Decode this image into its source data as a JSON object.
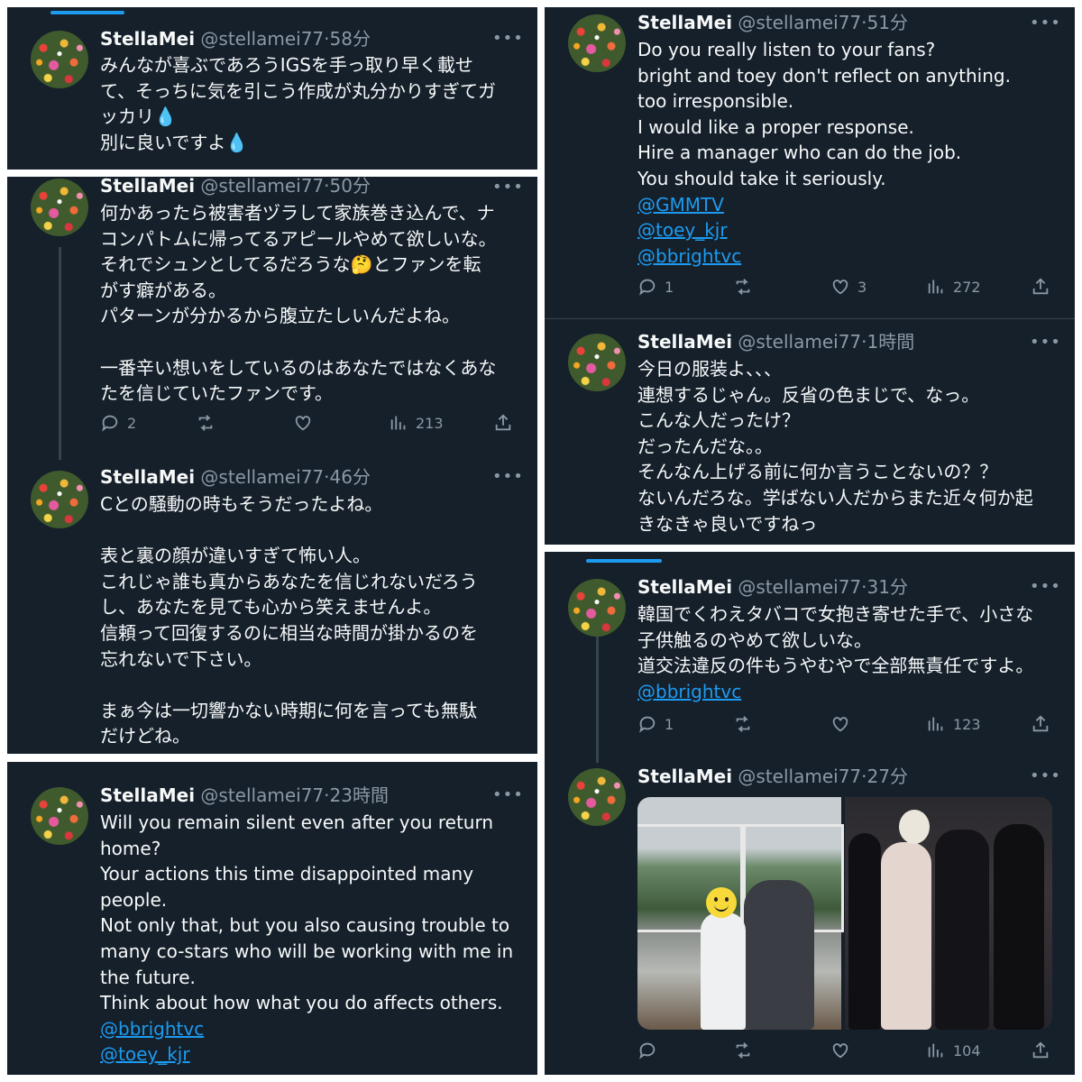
{
  "user": {
    "name": "StellaMei",
    "handle": "@stellamei77"
  },
  "tweets": [
    {
      "time": "·58分",
      "lines": [
        "みんなが喜ぶであろうIGSを手っ取り早く載せ",
        "て、そっちに気を引こう作成が丸分かりすぎてガ",
        "ッカリ💧",
        "別に良いですよ💧"
      ]
    },
    {
      "time": "·50分",
      "lines": [
        "何かあったら被害者ヅラして家族巻き込んで、ナ",
        "コンパトムに帰ってるアピールやめて欲しいな。",
        "それでシュンとしてるだろうな🤔とファンを転",
        "がす癖がある。",
        "パターンが分かるから腹立たしいんだよね。",
        "",
        "一番辛い想いをしているのはあなたではなくあな",
        "たを信じていたファンです。"
      ],
      "replies": "2",
      "retweets": "",
      "likes": "",
      "views": "213"
    },
    {
      "time": "·46分",
      "lines": [
        "Cとの騒動の時もそうだったよね。",
        "",
        "表と裏の顔が違いすぎて怖い人。",
        "これじゃ誰も真からあなたを信じれないだろう",
        "し、あなたを見ても心から笑えませんよ。",
        "信頼って回復するのに相当な時間が掛かるのを",
        "忘れないで下さい。",
        "",
        "まぁ今は一切響かない時期に何を言っても無駄",
        "だけどね。"
      ]
    },
    {
      "time": "·23時間",
      "lines": [
        "Will you remain silent even after you return",
        "home?",
        "Your actions this time disappointed many",
        "people.",
        "Not only that, but you also causing trouble to",
        "many co-stars who will be working with me in",
        "the future.",
        "Think about how what you do affects others."
      ],
      "links": [
        "@bbrightvc",
        "@toey_kjr"
      ]
    },
    {
      "time": "·51分",
      "lines": [
        "Do you really listen to your fans?",
        "bright and toey don't reflect on anything.",
        "too irresponsible.",
        "I would like a proper response.",
        "Hire a manager who can do the job.",
        "You should take it seriously."
      ],
      "links": [
        "@GMMTV",
        "@toey_kjr",
        "@bbrightvc"
      ],
      "replies": "1",
      "retweets": "",
      "likes": "3",
      "views": "272"
    },
    {
      "time": "·1時間",
      "lines": [
        "今日の服装よ、、、",
        "連想するじゃん。反省の色まじで、なっ。",
        "こんな人だったけ？",
        "だったんだな。。",
        "そんなん上げる前に何か言うことないの？？",
        "ないんだろな。学ばない人だからまた近々何か起",
        "きなきゃ良いですねっ"
      ]
    },
    {
      "time": "·31分",
      "lines": [
        "韓国でくわえタバコで女抱き寄せた手で、小さな",
        "子供触るのやめて欲しいな。",
        "道交法違反の件もうやむやで全部無責任ですよ。"
      ],
      "links": [
        "@bbrightvc"
      ],
      "replies": "1",
      "retweets": "",
      "likes": "",
      "views": "123"
    },
    {
      "time": "·27分",
      "lines": [],
      "replies": "",
      "retweets": "",
      "likes": "",
      "views": "104"
    }
  ],
  "icons": {
    "more": "more-icon",
    "reply": "reply-icon",
    "retweet": "retweet-icon",
    "like": "heart-icon",
    "views": "views-icon",
    "share": "share-icon"
  },
  "colors": {
    "background": "#15202b",
    "text": "#f7f9f9",
    "muted": "#8b98a5",
    "link": "#1d9bf0"
  }
}
